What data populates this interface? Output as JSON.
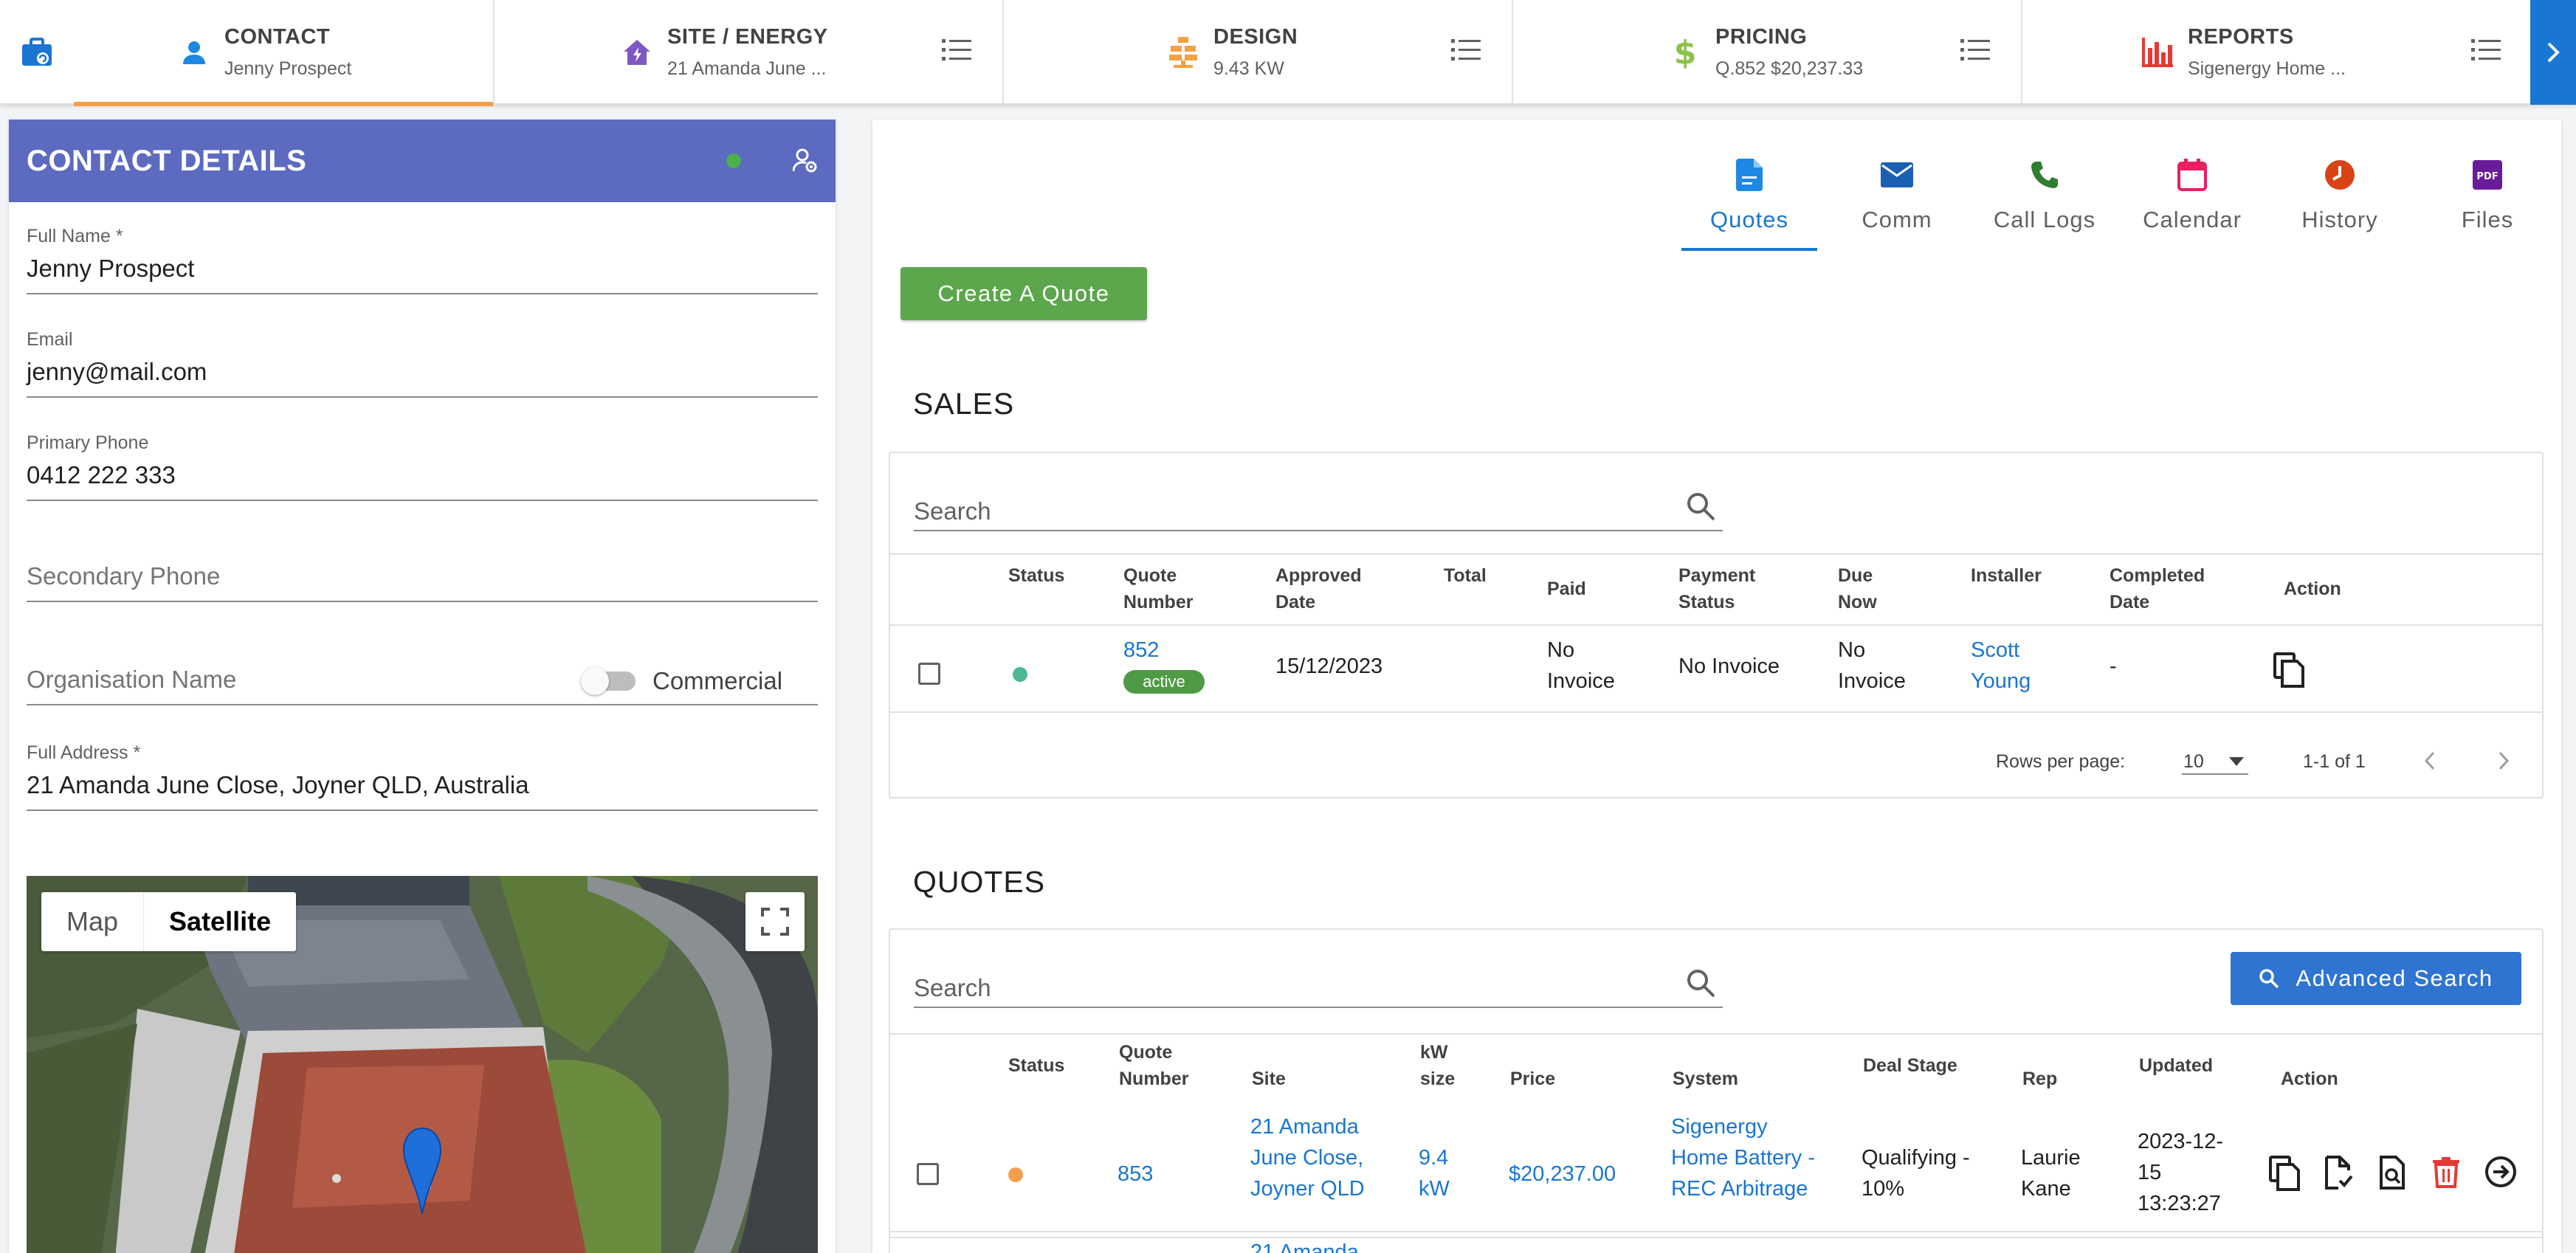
{
  "nav": {
    "tabs": [
      {
        "title": "CONTACT",
        "sub": "Jenny Prospect"
      },
      {
        "title": "SITE / ENERGY",
        "sub": "21 Amanda June ..."
      },
      {
        "title": "DESIGN",
        "sub": "9.43 KW"
      },
      {
        "title": "PRICING",
        "sub": "Q.852 $20,237.33"
      },
      {
        "title": "REPORTS",
        "sub": "Sigenergy Home ..."
      }
    ]
  },
  "contact": {
    "title": "CONTACT DETAILS",
    "full_name_label": "Full Name *",
    "full_name": "Jenny Prospect",
    "email_label": "Email",
    "email": "jenny@mail.com",
    "primary_phone_label": "Primary Phone",
    "primary_phone": "0412 222 333",
    "secondary_phone_placeholder": "Secondary Phone",
    "organisation_placeholder": "Organisation Name",
    "commercial_label": "Commercial",
    "address_label": "Full Address *",
    "address": "21 Amanda June Close, Joyner QLD, Australia"
  },
  "map": {
    "type_map": "Map",
    "type_satellite": "Satellite"
  },
  "right_tabs": [
    {
      "label": "Quotes"
    },
    {
      "label": "Comm"
    },
    {
      "label": "Call Logs"
    },
    {
      "label": "Calendar"
    },
    {
      "label": "History"
    },
    {
      "label": "Files"
    }
  ],
  "create_quote_label": "Create A Quote",
  "sales": {
    "title": "SALES",
    "search_placeholder": "Search",
    "headers": {
      "status": "Status",
      "quote_number": "Quote Number",
      "approved_date": "Approved Date",
      "total": "Total",
      "paid": "Paid",
      "payment_status": "Payment Status",
      "due_now": "Due Now",
      "installer": "Installer",
      "completed_date": "Completed Date",
      "action": "Action"
    },
    "row": {
      "quote_number": "852",
      "badge": "active",
      "approved_date": "15/12/2023",
      "total": "",
      "paid": "No Invoice",
      "payment_status": "No Invoice",
      "due_now": "No Invoice",
      "installer": "Scott Young",
      "completed_date": "-"
    },
    "pager": {
      "rows_per_page_label": "Rows per page:",
      "rows_per_page": "10",
      "range": "1-1 of 1"
    }
  },
  "quotes": {
    "title": "QUOTES",
    "search_placeholder": "Search",
    "advanced_search_label": "Advanced Search",
    "headers": {
      "status": "Status",
      "quote_number": "Quote Number",
      "site": "Site",
      "kw_size": "kW size",
      "price": "Price",
      "system": "System",
      "deal_stage": "Deal Stage",
      "rep": "Rep",
      "updated": "Updated",
      "action": "Action"
    },
    "row": {
      "quote_number": "853",
      "site": "21 Amanda June Close, Joyner QLD",
      "kw_size": "9.4 kW",
      "price": "$20,237.00",
      "system": "Sigenergy Home Battery - REC Arbitrage",
      "deal_stage": "Qualifying - 10%",
      "rep": "Laurie Kane",
      "updated": "2023-12-15 13:23:27"
    },
    "next_row_site_partial": "21 Amanda"
  },
  "colors": {
    "primary": "#1976d2",
    "header_indigo": "#5c6bc0",
    "create_green": "#5ca64c",
    "status_green": "#4db892",
    "status_orange": "#f0a04b",
    "delete_red": "#e53935"
  }
}
